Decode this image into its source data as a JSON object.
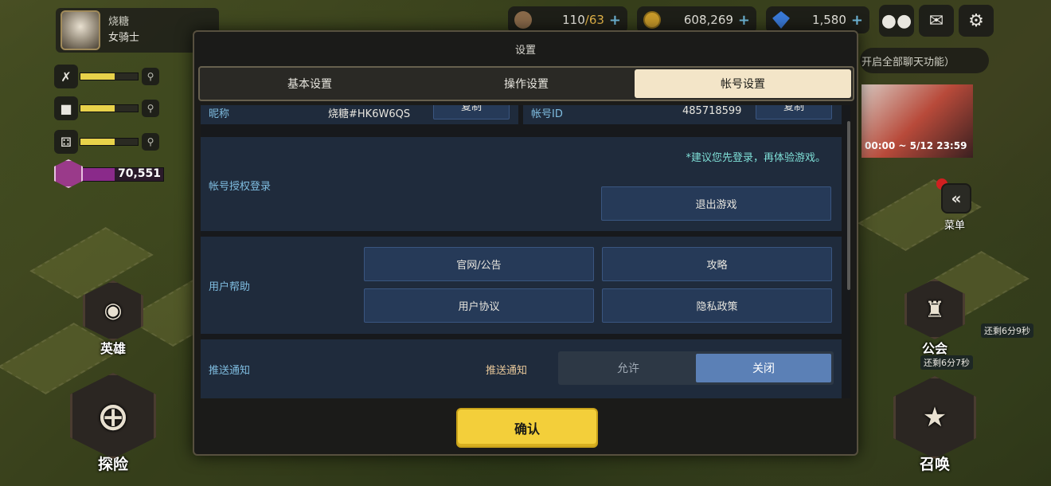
{
  "hud": {
    "player_name": "烧糖",
    "player_class": "女骑士",
    "stamina": "110/63",
    "stamina_value": "110",
    "stamina_max": "/63",
    "gold": "608,269",
    "gems": "1,580",
    "plus": "+",
    "chat_hint": "开启全部聊天功能）",
    "event_time": "00:00 ~ 5/12 23:59",
    "gem_points": "70,551",
    "stat_fill": [
      0.6,
      0.6,
      0.6
    ],
    "gem_fill": 0.42
  },
  "nav": {
    "heroes": "英雄",
    "explore": "探险",
    "guild": "公会",
    "summon": "召唤",
    "menu": "菜单",
    "menu_glyph": "«",
    "timer_1": "还剩6分9秒",
    "timer_2": "还剩6分7秒"
  },
  "modal": {
    "title": "设置",
    "tabs": [
      "基本设置",
      "操作设置",
      "帐号设置"
    ],
    "active_tab": 2,
    "partial_row": {
      "nickname_label": "昵称",
      "nickname_value": "烧糖#HK6W6QS",
      "copy_1": "复制",
      "account_id_label": "帐号ID",
      "account_id_value": "485718599",
      "copy_2": "复制"
    },
    "account_login": {
      "label": "帐号授权登录",
      "notice": "*建议您先登录，再体验游戏。",
      "logout_button": "退出游戏"
    },
    "user_help": {
      "label": "用户帮助",
      "buttons": [
        "官网/公告",
        "攻略",
        "用户协议",
        "隐私政策"
      ]
    },
    "push": {
      "label": "推送通知",
      "sub_label": "推送通知",
      "options": [
        "允许",
        "关闭"
      ],
      "selected": 1
    },
    "confirm": "确认"
  },
  "colors": {
    "accent_yellow": "#f3cf3a",
    "tab_active": "#f3e5c8",
    "label_blue": "#7fbde0",
    "toggle_selected": "#5b80b6"
  }
}
